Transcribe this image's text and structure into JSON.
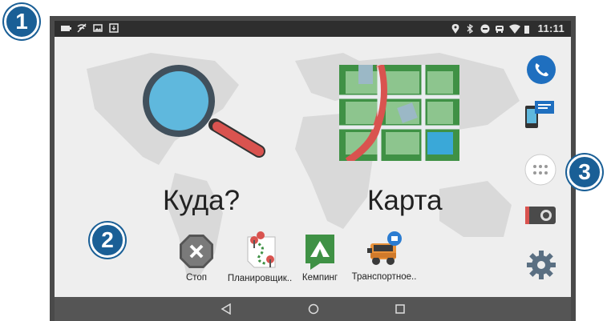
{
  "status_bar": {
    "time": "11:11",
    "left_icons": [
      "battery-icon",
      "no-wifi-icon",
      "image-icon",
      "download-icon"
    ],
    "right_icons": [
      "location-icon",
      "bluetooth-icon",
      "do-not-disturb-icon",
      "traffic-icon",
      "wifi-icon",
      "signal-icon"
    ]
  },
  "main": {
    "where_to_label": "Куда?",
    "map_label": "Карта"
  },
  "apps": [
    {
      "label": "Стоп",
      "icon": "stop-icon"
    },
    {
      "label": "Планировщик..",
      "icon": "trip-planner-icon"
    },
    {
      "label": "Кемпинг",
      "icon": "camping-icon"
    },
    {
      "label": "Транспортное..",
      "icon": "vehicle-icon"
    }
  ],
  "sidebar": [
    "phone-icon",
    "messages-icon",
    "apps-icon",
    "camera-icon",
    "settings-icon"
  ],
  "nav_bar": [
    "back-icon",
    "home-icon",
    "recents-icon"
  ],
  "callouts": [
    "1",
    "2",
    "3"
  ],
  "colors": {
    "accent_blue": "#1a5f96",
    "status_bar": "#2e2e2e",
    "nav_bar": "#555555"
  }
}
